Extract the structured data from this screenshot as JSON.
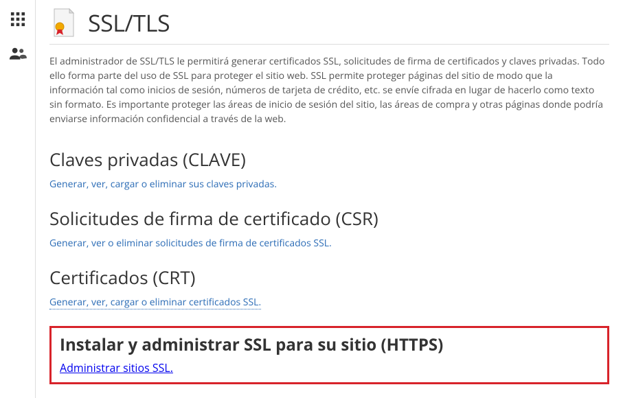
{
  "sidebar": {
    "apps_icon": "apps-grid-icon",
    "users_icon": "users-icon"
  },
  "header": {
    "title": "SSL/TLS",
    "icon": "certificate-icon"
  },
  "intro": "El administrador de SSL/TLS le permitirá generar certificados SSL, solicitudes de firma de certificados y claves privadas. Todo ello forma parte del uso de SSL para proteger el sitio web. SSL permite proteger páginas del sitio de modo que la información tal como inicios de sesión, números de tarjeta de crédito, etc. se envíe cifrada en lugar de hacerlo como texto sin formato. Es importante proteger las áreas de inicio de sesión del sitio, las áreas de compra y otras páginas donde podría enviarse información confidencial a través de la web.",
  "sections": {
    "keys": {
      "heading": "Claves privadas (CLAVE)",
      "link": "Generar, ver, cargar o eliminar sus claves privadas."
    },
    "csr": {
      "heading": "Solicitudes de firma de certificado (CSR)",
      "link": "Generar, ver o eliminar solicitudes de firma de certificados SSL."
    },
    "crt": {
      "heading": "Certificados (CRT)",
      "link": "Generar, ver, cargar o eliminar certificados SSL."
    },
    "install": {
      "heading": "Instalar y administrar SSL para su sitio (HTTPS)",
      "link": "Administrar sitios SSL."
    }
  }
}
